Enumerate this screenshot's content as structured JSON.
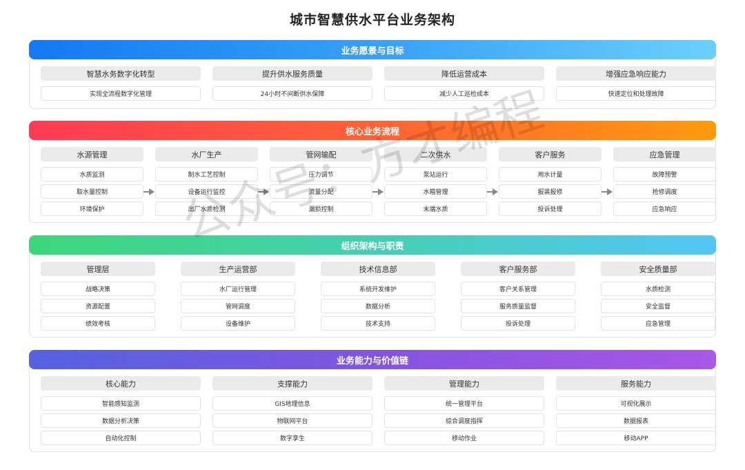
{
  "title": "城市智慧供水平台业务架构",
  "watermark": "公众号：方才编程",
  "colors": {
    "vision": [
      "#1479f2",
      "#6bd0fb"
    ],
    "process": [
      "#ff3a55",
      "#ff9a0c"
    ],
    "org": [
      "#3dd77a",
      "#55c6f7"
    ],
    "capability": [
      "#5463e0",
      "#a957e6"
    ],
    "header_bg": "#ebebeb",
    "arrow": "#888888"
  },
  "sections": {
    "vision": {
      "title": "业务愿景与目标",
      "columns": [
        {
          "header": "智慧水务数字化转型",
          "items": [
            "实现全流程数字化管理"
          ]
        },
        {
          "header": "提升供水服务质量",
          "items": [
            "24小时不间断供水保障"
          ]
        },
        {
          "header": "降低运营成本",
          "items": [
            "减少人工巡检成本"
          ]
        },
        {
          "header": "增强应急响应能力",
          "items": [
            "快速定位和处理故障"
          ]
        }
      ]
    },
    "process": {
      "title": "核心业务流程",
      "columns": [
        {
          "header": "水源管理",
          "items": [
            "水质监测",
            "取水量控制",
            "环境保护"
          ]
        },
        {
          "header": "水厂生产",
          "items": [
            "制水工艺控制",
            "设备运行监控",
            "出厂水质检测"
          ]
        },
        {
          "header": "管网输配",
          "items": [
            "压力调节",
            "流量分配",
            "漏损控制"
          ]
        },
        {
          "header": "二次供水",
          "items": [
            "泵站运行",
            "水箱管理",
            "末端水质"
          ]
        },
        {
          "header": "客户服务",
          "items": [
            "用水计量",
            "报装报修",
            "投诉处理"
          ]
        },
        {
          "header": "应急管理",
          "items": [
            "故障预警",
            "抢修调度",
            "应急响应"
          ]
        }
      ]
    },
    "org": {
      "title": "组织架构与职责",
      "columns": [
        {
          "header": "管理层",
          "items": [
            "战略决策",
            "资源配置",
            "绩效考核"
          ]
        },
        {
          "header": "生产运营部",
          "items": [
            "水厂运行管理",
            "管网调度",
            "设备维护"
          ]
        },
        {
          "header": "技术信息部",
          "items": [
            "系统开发维护",
            "数据分析",
            "技术支持"
          ]
        },
        {
          "header": "客户服务部",
          "items": [
            "客户关系管理",
            "服务质量监督",
            "投诉处理"
          ]
        },
        {
          "header": "安全质量部",
          "items": [
            "水质检测",
            "安全监督",
            "应急管理"
          ]
        }
      ]
    },
    "capability": {
      "title": "业务能力与价值链",
      "columns": [
        {
          "header": "核心能力",
          "items": [
            "智能感知监测",
            "数据分析决策",
            "自动化控制"
          ]
        },
        {
          "header": "支撑能力",
          "items": [
            "GIS地理信息",
            "物联网平台",
            "数字孪生"
          ]
        },
        {
          "header": "管理能力",
          "items": [
            "统一管理平台",
            "综合调度指挥",
            "移动作业"
          ]
        },
        {
          "header": "服务能力",
          "items": [
            "可视化展示",
            "数据报表",
            "移动APP"
          ]
        }
      ]
    }
  }
}
